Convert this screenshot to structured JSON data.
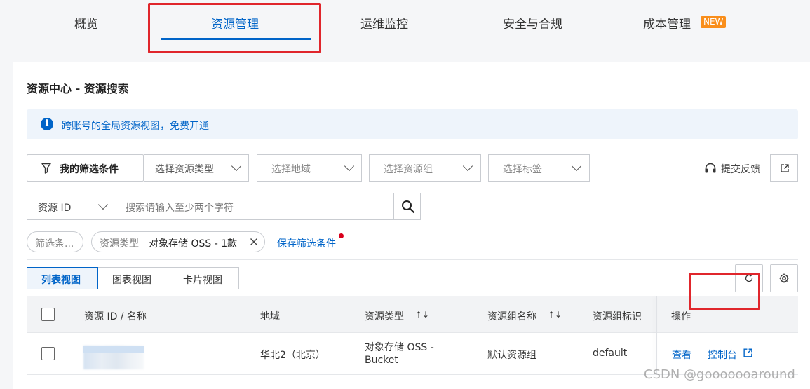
{
  "top_tabs": [
    {
      "label": "概览"
    },
    {
      "label": "资源管理",
      "active": true
    },
    {
      "label": "运维监控"
    },
    {
      "label": "安全与合规"
    },
    {
      "label": "成本管理",
      "badge": "NEW"
    }
  ],
  "page_title": "资源中心 - 资源搜索",
  "notice": {
    "icon": "info-icon",
    "text": "跨账号的全局资源视图，免费开通"
  },
  "filters": {
    "my_filters_label": "我的筛选条件",
    "selects": [
      {
        "placeholder": "选择资源类型"
      },
      {
        "placeholder": "选择地域"
      },
      {
        "placeholder": "选择资源组"
      },
      {
        "placeholder": "选择标签"
      }
    ],
    "feedback_label": "提交反馈"
  },
  "search": {
    "field_select": "资源 ID",
    "placeholder": "搜索请输入至少两个字符"
  },
  "chips": {
    "filter_chip": "筛选条...",
    "active_chip_key": "资源类型",
    "active_chip_value": "对象存储 OSS - 1款",
    "save_filter_link": "保存筛选条件"
  },
  "views": [
    "列表视图",
    "图表视图",
    "卡片视图"
  ],
  "active_view": "列表视图",
  "table": {
    "headers": [
      "资源 ID / 名称",
      "地域",
      "资源类型",
      "资源组名称",
      "资源组标识",
      "操作"
    ],
    "rows": [
      {
        "region": "华北2（北京）",
        "type_line1": "对象存储 OSS -",
        "type_line2": "Bucket",
        "group_name": "默认资源组",
        "group_id": "default",
        "action_view": "查看",
        "action_console": "控制台"
      }
    ]
  },
  "watermark": "CSDN @gooooooaround",
  "colors": {
    "accent": "#0064c8",
    "highlight": "#e0262c",
    "badge": "#f98e1b"
  }
}
